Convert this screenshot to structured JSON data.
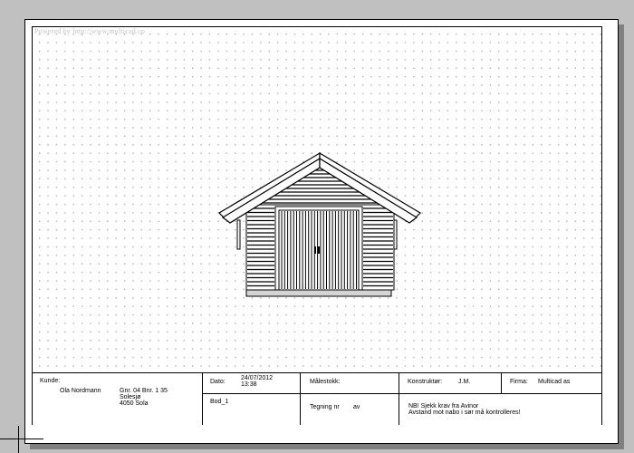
{
  "watermark": "Powered by http://www.multicad.co",
  "title_block": {
    "customer_label": "Kunde:",
    "customer_name": "Ola Nordmann",
    "property_line1": "Gnr. 04 Bnr. 1 35",
    "property_line2": "Solesjø",
    "property_line3": "4050 Sola",
    "date_label": "Dato:",
    "date_value": "24/07/2012",
    "time_value": "13:38",
    "drawing_name": "Bod_1",
    "scale_label": "Målestokk:",
    "drawing_number_label": "Tegning nr",
    "drawing_of_label": "av",
    "designer_label": "Konstruktør:",
    "designer_value": "J.M.",
    "company_label": "Firma:",
    "company_value": "Multicad as",
    "note_line1": "NB! Sjekk krav fra Avinor",
    "note_line2": "Avstand mot nabo i sør må kontrolleres!"
  }
}
